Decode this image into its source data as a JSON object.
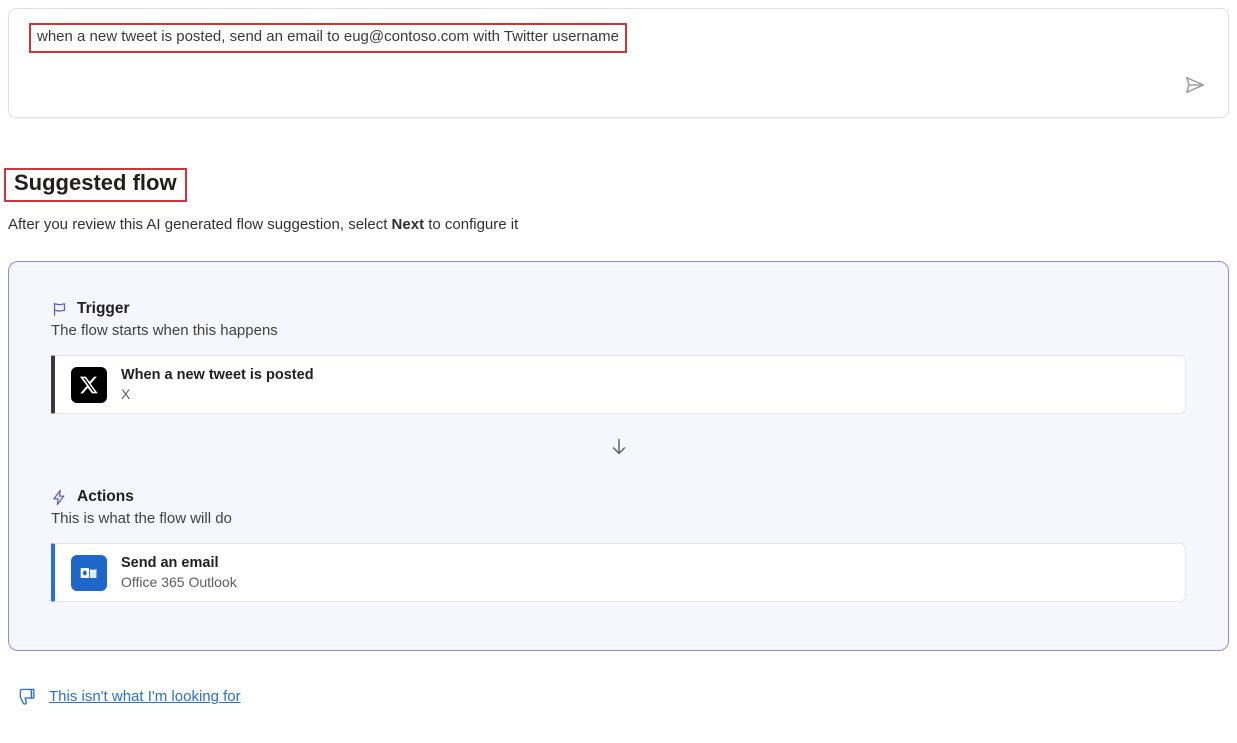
{
  "prompt": {
    "text": "when a new tweet is posted, send an email to eug@contoso.com with Twitter username"
  },
  "suggested": {
    "title": "Suggested flow",
    "subtitle_pre": "After you review this AI generated flow suggestion, select ",
    "subtitle_bold": "Next",
    "subtitle_post": " to configure it"
  },
  "trigger": {
    "label": "Trigger",
    "desc": "The flow starts when this happens",
    "step_title": "When a new tweet is posted",
    "step_sub": "X"
  },
  "actions": {
    "label": "Actions",
    "desc": "This is what the flow will do",
    "step_title": "Send an email",
    "step_sub": "Office 365 Outlook"
  },
  "feedback": {
    "link": "This isn't what I'm looking for"
  }
}
